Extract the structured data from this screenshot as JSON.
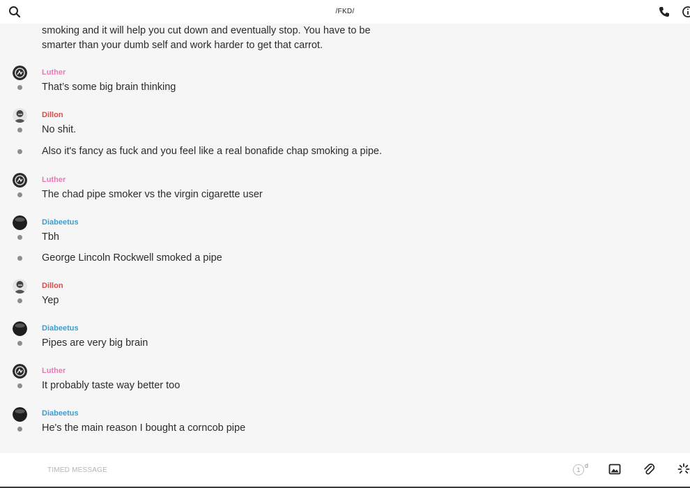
{
  "header": {
    "title": "/FKD/"
  },
  "icons": {
    "search": "search-icon",
    "phone": "phone-icon",
    "info": "info-icon",
    "image": "image-icon",
    "attach": "paperclip-icon",
    "loading": "loading-spinner-icon"
  },
  "colors": {
    "Luther": "#e879b8",
    "Dillon": "#e04848",
    "Diabeetus": "#3a9ed1"
  },
  "chat": {
    "continuation_text": "smoking and it will help you cut down and eventually stop. You have to be smarter than your dumb self and work harder to get that carrot.",
    "groups": [
      {
        "sender": "Luther",
        "messages": [
          "That’s some big brain thinking"
        ]
      },
      {
        "sender": "Dillon",
        "messages": [
          "No shit.",
          "Also it's fancy as fuck and you feel like a real bonafide chap smoking a pipe."
        ]
      },
      {
        "sender": "Luther",
        "messages": [
          "The chad pipe smoker vs the virgin cigarette user"
        ]
      },
      {
        "sender": "Diabeetus",
        "messages": [
          "Tbh",
          "George Lincoln Rockwell smoked a pipe"
        ]
      },
      {
        "sender": "Dillon",
        "messages": [
          "Yep"
        ]
      },
      {
        "sender": "Diabeetus",
        "messages": [
          "Pipes are very big brain"
        ]
      },
      {
        "sender": "Luther",
        "messages": [
          "It probably taste way better too"
        ]
      },
      {
        "sender": "Diabeetus",
        "messages": [
          "He's the main reason I bought a corncob pipe"
        ]
      }
    ]
  },
  "compose": {
    "placeholder": "TIMED MESSAGE",
    "timer_value": "1",
    "timer_unit": "d"
  }
}
